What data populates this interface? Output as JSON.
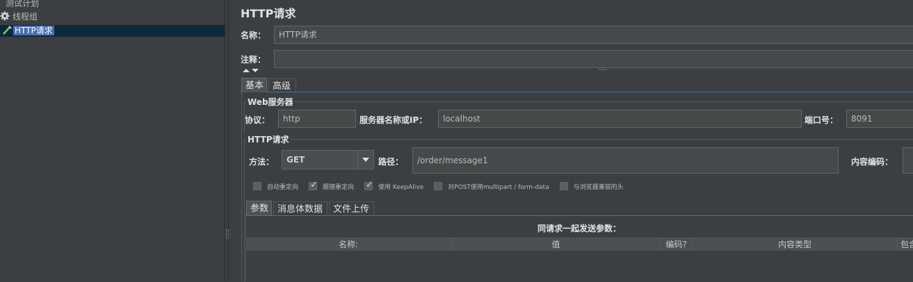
{
  "tree": {
    "items": [
      {
        "label": "测试计划"
      },
      {
        "label": "线程组",
        "icon": "gear-icon"
      },
      {
        "label": "HTTP请求",
        "icon": "pipette-icon",
        "selected": true
      }
    ]
  },
  "editor": {
    "title": "HTTP请求",
    "name_label": "名称：",
    "name_value": "HTTP请求",
    "comment_label": "注释：",
    "comment_value": "",
    "collapse_grip": "\"\"\"\""
  },
  "tabs": [
    {
      "label": "基本",
      "selected": true
    },
    {
      "label": "高级",
      "selected": false
    }
  ],
  "web_server": {
    "group_title": "Web服务器",
    "protocol_label": "协议：",
    "protocol_value": "http",
    "server_label": "服务器名称或IP：",
    "server_value": "localhost",
    "port_label": "端口号：",
    "port_value": "8091"
  },
  "http_request": {
    "group_title": "HTTP请求",
    "method_label": "方法：",
    "method_value": "GET",
    "path_label": "路径：",
    "path_value": "/order/message1",
    "encoding_label": "内容编码：",
    "encoding_value": ""
  },
  "options": [
    {
      "label": "自动重定向",
      "checked": false
    },
    {
      "label": "跟随重定向",
      "checked": true
    },
    {
      "label": "使用 KeepAlive",
      "checked": true
    },
    {
      "label": "对POST使用multipart / form-data",
      "checked": false
    },
    {
      "label": "与浏览器兼容的头",
      "checked": false
    }
  ],
  "sub_tabs": [
    {
      "label": "参数",
      "selected": true
    },
    {
      "label": "消息体数据",
      "selected": false
    },
    {
      "label": "文件上传",
      "selected": false
    }
  ],
  "params": {
    "caption": "同请求一起发送参数：",
    "columns": [
      "名称:",
      "值",
      "编码?",
      "内容类型",
      "包含"
    ]
  },
  "colors": {
    "background": "#3c3f41",
    "selection": "#4b6eaf",
    "field": "#45494a"
  }
}
